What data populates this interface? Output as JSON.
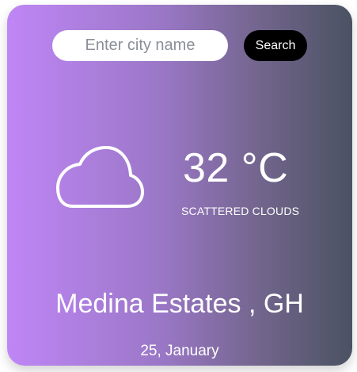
{
  "search": {
    "placeholder": "Enter city name",
    "value": "",
    "button_label": "Search"
  },
  "weather": {
    "icon": "cloud-icon",
    "temperature": "32 °C",
    "description": "SCATTERED CLOUDS",
    "location": "Medina Estates , GH",
    "date": "25, January"
  },
  "colors": {
    "gradient_start": "#bf86f6",
    "gradient_end": "#4a5262",
    "button_bg": "#000000",
    "text": "#ffffff"
  }
}
